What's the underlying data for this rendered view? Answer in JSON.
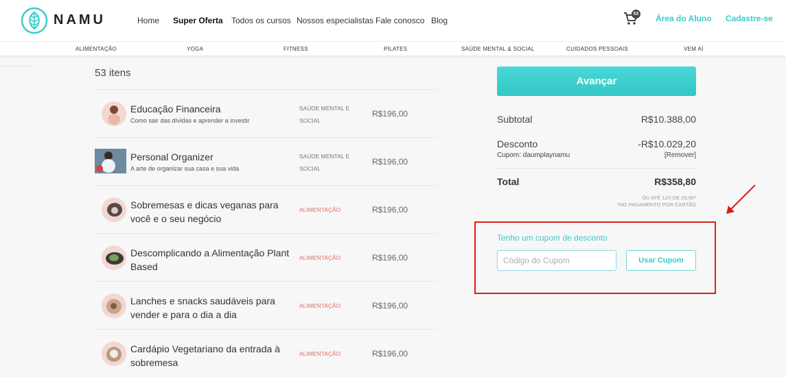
{
  "header": {
    "brand": "NAMU",
    "nav": [
      "Home",
      "Super Oferta",
      "Todos os cursos",
      "Nossos especialistas",
      "Fale conosco",
      "Blog"
    ],
    "active_nav": "Super Oferta",
    "cart_count": "53",
    "student_area": "Área do Aluno",
    "signup": "Cadastre-se"
  },
  "categories": [
    "ALIMENTAÇÃO",
    "YOGA",
    "FITNESS",
    "PILATES",
    "SAÚDE MENTAL & SOCIAL",
    "CUIDADOS PESSOAIS",
    "VEM AÍ"
  ],
  "cart": {
    "count_label": "53 itens",
    "items": [
      {
        "title": "Educação Financeira",
        "subtitle": "Como sair das dívidas e aprender a investir",
        "category": "SAÚDE MENTAL E SOCIAL",
        "price": "R$196,00"
      },
      {
        "title": "Personal Organizer",
        "subtitle": "A arte de organizar sua casa e sua vida",
        "category": "SAÚDE MENTAL E SOCIAL",
        "price": "R$196,00"
      },
      {
        "title": "Sobremesas e dicas veganas para você e o seu negócio",
        "subtitle": "",
        "category": "ALIMENTAÇÃO",
        "price": "R$196,00"
      },
      {
        "title": "Descomplicando a Alimentação Plant Based",
        "subtitle": "",
        "category": "ALIMENTAÇÃO",
        "price": "R$196,00"
      },
      {
        "title": "Lanches e snacks saudáveis para vender e para o dia a dia",
        "subtitle": "",
        "category": "ALIMENTAÇÃO",
        "price": "R$196,00"
      },
      {
        "title": "Cardápio Vegetariano da entrada à sobremesa",
        "subtitle": "",
        "category": "ALIMENTAÇÃO",
        "price": "R$196,00"
      }
    ]
  },
  "summary": {
    "advance_button": "Avançar",
    "subtotal_label": "Subtotal",
    "subtotal_value": "R$10.388,00",
    "discount_label": "Desconto",
    "discount_value": "-R$10.029,20",
    "coupon_line": "Cupom: daumplaynamu",
    "remove_label": "[Remover]",
    "total_label": "Total",
    "total_value": "R$358,80",
    "installments_note": "OU ATÉ 12X DE 29,90*",
    "card_note": "*NO PAGAMENTO POR CARTÃO"
  },
  "coupon": {
    "title": "Tenho um cupom de desconto",
    "placeholder": "Código do Cupom",
    "button": "Usar Cupom"
  },
  "colors": {
    "accent": "#3cc9c9",
    "highlight_box": "#e01a1a",
    "category_food": "#e76a6a"
  }
}
